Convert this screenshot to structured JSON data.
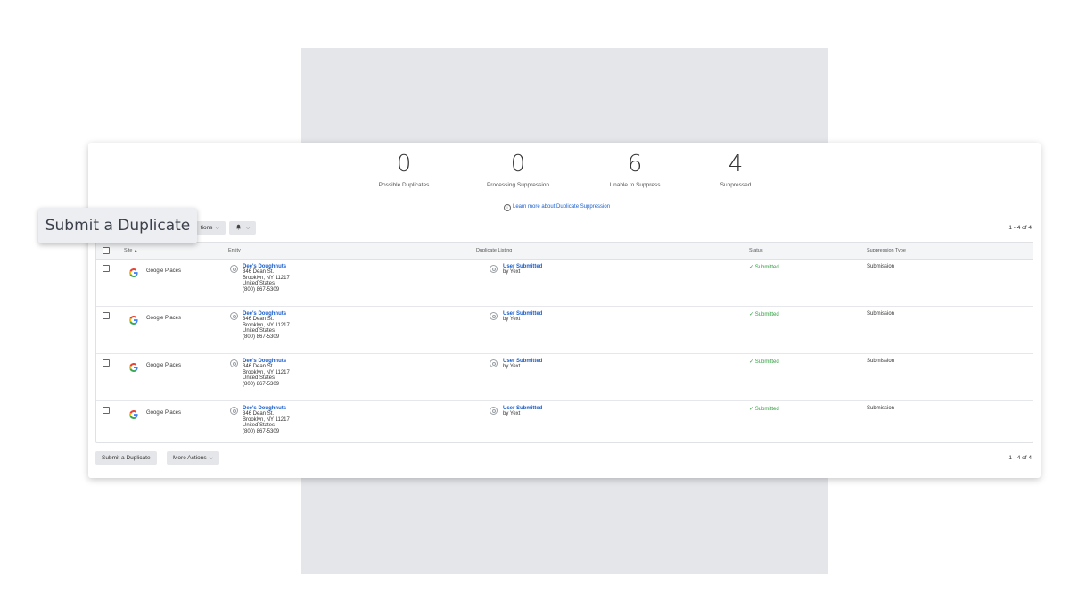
{
  "stats": [
    {
      "value": "0",
      "label": "Possible Duplicates"
    },
    {
      "value": "0",
      "label": "Processing Suppression"
    },
    {
      "value": "6",
      "label": "Unable to Suppress"
    },
    {
      "value": "4",
      "label": "Suppressed"
    }
  ],
  "learn_more": "Learn more about Duplicate Suppression",
  "learn_more_icon": "info-icon",
  "toolbar_top": {
    "actions_partial": "tions",
    "notify_icon": "bell-icon"
  },
  "pager_text": "1 - 4 of 4",
  "tooltip": "Submit a Duplicate",
  "table": {
    "headers": {
      "site": "Site",
      "site_sort": "▲",
      "entity": "Entity",
      "duplicate": "Duplicate Listing",
      "status": "Status",
      "type": "Suppression Type"
    },
    "rows": [
      {
        "site": "Google Places",
        "entity_name": "Dee's Doughnuts",
        "addr1": "346 Dean St.",
        "addr2": "Brooklyn, NY 11217",
        "addr3": "United States",
        "phone": "(800) 867-5309",
        "dup_name": "User Submitted",
        "dup_by": "by Yext",
        "status": "✓ Submitted",
        "type": "Submission"
      },
      {
        "site": "Google Places",
        "entity_name": "Dee's Doughnuts",
        "addr1": "346 Dean St.",
        "addr2": "Brooklyn, NY 11217",
        "addr3": "United States",
        "phone": "(800) 867-5309",
        "dup_name": "User Submitted",
        "dup_by": "by Yext",
        "status": "✓ Submitted",
        "type": "Submission"
      },
      {
        "site": "Google Places",
        "entity_name": "Dee's Doughnuts",
        "addr1": "346 Dean St.",
        "addr2": "Brooklyn, NY 11217",
        "addr3": "United States",
        "phone": "(800) 867-5309",
        "dup_name": "User Submitted",
        "dup_by": "by Yext",
        "status": "✓ Submitted",
        "type": "Submission"
      },
      {
        "site": "Google Places",
        "entity_name": "Dee's Doughnuts",
        "addr1": "346 Dean St.",
        "addr2": "Brooklyn, NY 11217",
        "addr3": "United States",
        "phone": "(800) 867-5309",
        "dup_name": "User Submitted",
        "dup_by": "by Yext",
        "status": "✓ Submitted",
        "type": "Submission"
      }
    ]
  },
  "toolbar_bottom": {
    "submit_label": "Submit a Duplicate",
    "more_actions_label": "More Actions",
    "chevron": "⌵"
  },
  "colors": {
    "link": "#1a5fcc",
    "success": "#2e9e3e",
    "backdrop": "#e4e6ea"
  }
}
